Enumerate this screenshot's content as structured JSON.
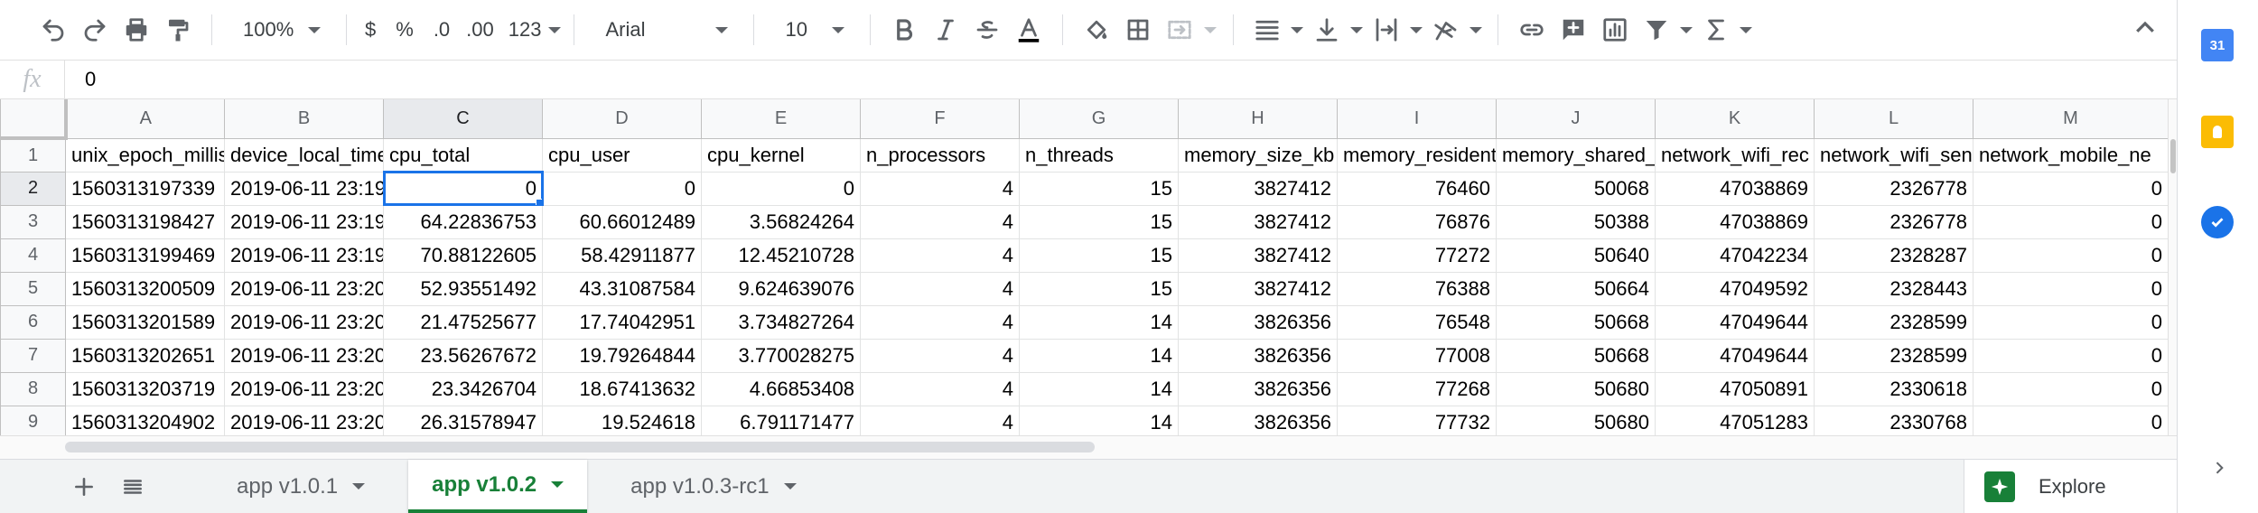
{
  "toolbar": {
    "zoom": "100%",
    "currency": "$",
    "percent": "%",
    "decrease_decimal": ".0",
    "increase_decimal": ".00",
    "number_format": "123",
    "font_family": "Arial",
    "font_size": "10"
  },
  "formula_bar": {
    "fx_label": "fx",
    "value": "0"
  },
  "columns": [
    "A",
    "B",
    "C",
    "D",
    "E",
    "F",
    "G",
    "H",
    "I",
    "J",
    "K",
    "L",
    "M"
  ],
  "selected_column": "C",
  "selected_row": "2",
  "rows": [
    {
      "n": "1",
      "cells": [
        "unix_epoch_millis",
        "device_local_time",
        "cpu_total",
        "cpu_user",
        "cpu_kernel",
        "n_processors",
        "n_threads",
        "memory_size_kb",
        "memory_resident",
        "memory_shared_kb",
        "network_wifi_rec",
        "network_wifi_sen",
        "network_mobile_ne"
      ]
    },
    {
      "n": "2",
      "cells": [
        "1560313197339",
        "2019-06-11 23:19",
        "0",
        "0",
        "0",
        "4",
        "15",
        "3827412",
        "76460",
        "50068",
        "47038869",
        "2326778",
        "0"
      ]
    },
    {
      "n": "3",
      "cells": [
        "1560313198427",
        "2019-06-11 23:19",
        "64.22836753",
        "60.66012489",
        "3.56824264",
        "4",
        "15",
        "3827412",
        "76876",
        "50388",
        "47038869",
        "2326778",
        "0"
      ]
    },
    {
      "n": "4",
      "cells": [
        "1560313199469",
        "2019-06-11 23:19",
        "70.88122605",
        "58.42911877",
        "12.45210728",
        "4",
        "15",
        "3827412",
        "77272",
        "50640",
        "47042234",
        "2328287",
        "0"
      ]
    },
    {
      "n": "5",
      "cells": [
        "1560313200509",
        "2019-06-11 23:20",
        "52.93551492",
        "43.31087584",
        "9.624639076",
        "4",
        "15",
        "3827412",
        "76388",
        "50664",
        "47049592",
        "2328443",
        "0"
      ]
    },
    {
      "n": "6",
      "cells": [
        "1560313201589",
        "2019-06-11 23:20",
        "21.47525677",
        "17.74042951",
        "3.734827264",
        "4",
        "14",
        "3826356",
        "76548",
        "50668",
        "47049644",
        "2328599",
        "0"
      ]
    },
    {
      "n": "7",
      "cells": [
        "1560313202651",
        "2019-06-11 23:20",
        "23.56267672",
        "19.79264844",
        "3.770028275",
        "4",
        "14",
        "3826356",
        "77008",
        "50668",
        "47049644",
        "2328599",
        "0"
      ]
    },
    {
      "n": "8",
      "cells": [
        "1560313203719",
        "2019-06-11 23:20",
        "23.3426704",
        "18.67413632",
        "4.66853408",
        "4",
        "14",
        "3826356",
        "77268",
        "50680",
        "47050891",
        "2330618",
        "0"
      ]
    },
    {
      "n": "9",
      "cells": [
        "1560313204902",
        "2019-06-11 23:20",
        "26.31578947",
        "19.524618",
        "6.791171477",
        "4",
        "14",
        "3826356",
        "77732",
        "50680",
        "47051283",
        "2330768",
        "0"
      ]
    }
  ],
  "sheet_tabs": [
    {
      "label": "app v1.0.1",
      "active": false
    },
    {
      "label": "app v1.0.2",
      "active": true
    },
    {
      "label": "app v1.0.3-rc1",
      "active": false
    }
  ],
  "explore_label": "Explore",
  "side_panel": {
    "calendar_day": "31"
  },
  "colors": {
    "accent": "#1a73e8",
    "active_tab": "#188038"
  }
}
